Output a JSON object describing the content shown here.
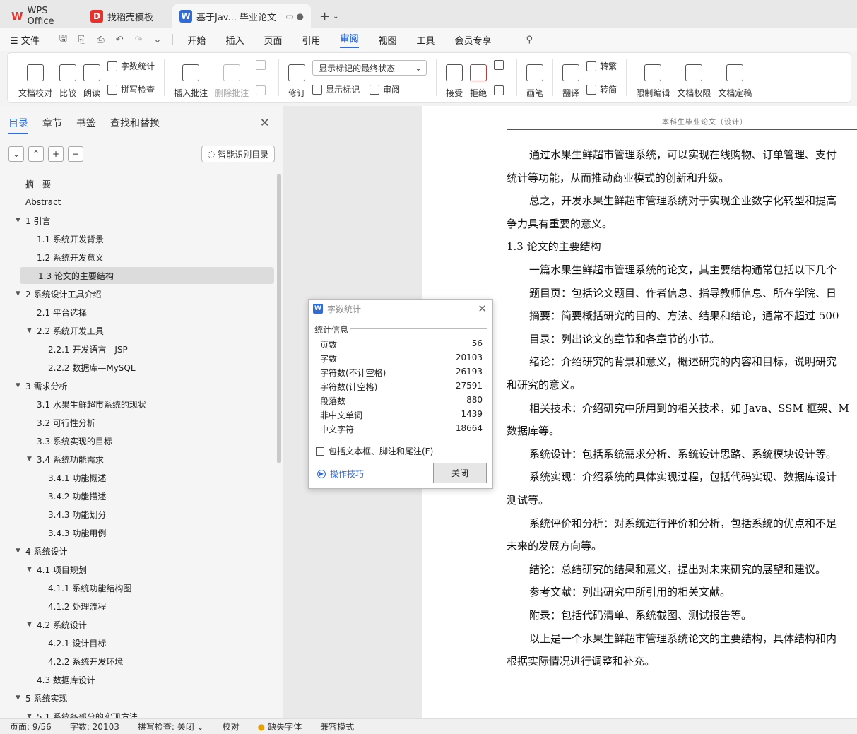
{
  "tabs": [
    {
      "label": "WPS Office",
      "icon": "wps-logo-icon"
    },
    {
      "label": "找稻壳模板",
      "icon": "docer-logo-icon"
    },
    {
      "label": "基于Jav... 毕业论文",
      "icon": "writer-logo-icon"
    }
  ],
  "menu": {
    "file": "文件",
    "items": [
      "开始",
      "插入",
      "页面",
      "引用",
      "审阅",
      "视图",
      "工具",
      "会员专享"
    ],
    "active": "审阅"
  },
  "ribbon": {
    "doc_check": "文档校对",
    "compare": "比较",
    "read_aloud": "朗读",
    "word_count": "字数统计",
    "spell_check": "拼写检查",
    "insert_comment": "插入批注",
    "delete_comment": "删除批注",
    "revise": "修订",
    "markup_state": "显示标记的最终状态",
    "show_markup": "显示标记",
    "review_pane": "审阅",
    "accept": "接受",
    "reject": "拒绝",
    "pen": "画笔",
    "translate": "翻译",
    "to_traditional": "转繁",
    "to_simplified": "转简",
    "restrict_edit": "限制编辑",
    "doc_permission": "文档权限",
    "doc_finalize": "文档定稿"
  },
  "nav": {
    "tabs": [
      "目录",
      "章节",
      "书签",
      "查找和替换"
    ],
    "active_tab": "目录",
    "smart_toc": "智能识别目录",
    "items": [
      {
        "label": "摘　要",
        "level": 0,
        "arrow": false
      },
      {
        "label": "Abstract",
        "level": 0,
        "arrow": false
      },
      {
        "label": "1 引言",
        "level": 0,
        "arrow": true
      },
      {
        "label": "1.1  系统开发背景",
        "level": 1,
        "arrow": false
      },
      {
        "label": "1.2  系统开发意义",
        "level": 1,
        "arrow": false
      },
      {
        "label": "1.3 论文的主要结构",
        "level": 1,
        "arrow": false,
        "selected": true
      },
      {
        "label": "2 系统设计工具介绍",
        "level": 0,
        "arrow": true
      },
      {
        "label": "2.1  平台选择",
        "level": 1,
        "arrow": false
      },
      {
        "label": "2.2  系统开发工具",
        "level": 1,
        "arrow": true
      },
      {
        "label": "2.2.1  开发语言—JSP",
        "level": 2,
        "arrow": false
      },
      {
        "label": "2.2.2  数据库—MySQL",
        "level": 2,
        "arrow": false
      },
      {
        "label": "3  需求分析",
        "level": 0,
        "arrow": true
      },
      {
        "label": "3.1  水果生鲜超市系统的现状",
        "level": 1,
        "arrow": false
      },
      {
        "label": "3.2  可行性分析",
        "level": 1,
        "arrow": false
      },
      {
        "label": "3.3  系统实现的目标",
        "level": 1,
        "arrow": false
      },
      {
        "label": "3.4  系统功能需求",
        "level": 1,
        "arrow": true
      },
      {
        "label": "3.4.1  功能概述",
        "level": 2,
        "arrow": false
      },
      {
        "label": "3.4.2  功能描述",
        "level": 2,
        "arrow": false
      },
      {
        "label": "3.4.3  功能划分",
        "level": 2,
        "arrow": false
      },
      {
        "label": "3.4.3  功能用例",
        "level": 2,
        "arrow": false
      },
      {
        "label": "4  系统设计",
        "level": 0,
        "arrow": true
      },
      {
        "label": "4.1  项目规划",
        "level": 1,
        "arrow": true
      },
      {
        "label": "4.1.1  系统功能结构图",
        "level": 2,
        "arrow": false
      },
      {
        "label": "4.1.2  处理流程",
        "level": 2,
        "arrow": false
      },
      {
        "label": "4.2  系统设计",
        "level": 1,
        "arrow": true
      },
      {
        "label": "4.2.1  设计目标",
        "level": 2,
        "arrow": false
      },
      {
        "label": "4.2.2  系统开发环境",
        "level": 2,
        "arrow": false
      },
      {
        "label": "4.3  数据库设计",
        "level": 1,
        "arrow": false
      },
      {
        "label": "5  系统实现",
        "level": 0,
        "arrow": true
      },
      {
        "label": "5.1  系统各部分的实现方法",
        "level": 1,
        "arrow": true
      }
    ]
  },
  "document": {
    "header": "本科生毕业论文（设计）",
    "lines": [
      {
        "text": "通过水果生鲜超市管理系统，可以实现在线购物、订单管理、支付",
        "indent": true
      },
      {
        "text": "统计等功能，从而推动商业模式的创新和升级。",
        "indent": false
      },
      {
        "text": "总之，开发水果生鲜超市管理系统对于实现企业数字化转型和提高",
        "indent": true
      },
      {
        "text": "争力具有重要的意义。",
        "indent": false
      },
      {
        "text": "1.3 论文的主要结构",
        "indent": false
      },
      {
        "text": "一篇水果生鲜超市管理系统的论文，其主要结构通常包括以下几个",
        "indent": true
      },
      {
        "text": "题目页：包括论文题目、作者信息、指导教师信息、所在学院、日",
        "indent": true
      },
      {
        "text": "摘要：简要概括研究的目的、方法、结果和结论，通常不超过 500",
        "indent": true
      },
      {
        "text": "目录：列出论文的章节和各章节的小节。",
        "indent": true
      },
      {
        "text": "绪论：介绍研究的背景和意义，概述研究的内容和目标，说明研究",
        "indent": true
      },
      {
        "text": "和研究的意义。",
        "indent": false
      },
      {
        "text": "相关技术：介绍研究中所用到的相关技术，如 Java、SSM 框架、M",
        "indent": true
      },
      {
        "text": "数据库等。",
        "indent": false
      },
      {
        "text": "系统设计：包括系统需求分析、系统设计思路、系统模块设计等。",
        "indent": true
      },
      {
        "text": "系统实现：介绍系统的具体实现过程，包括代码实现、数据库设计",
        "indent": true
      },
      {
        "text": "测试等。",
        "indent": false
      },
      {
        "text": "系统评价和分析：对系统进行评价和分析，包括系统的优点和不足",
        "indent": true
      },
      {
        "text": "未来的发展方向等。",
        "indent": false
      },
      {
        "text": "结论：总结研究的结果和意义，提出对未来研究的展望和建议。",
        "indent": true
      },
      {
        "text": "参考文献：列出研究中所引用的相关文献。",
        "indent": true
      },
      {
        "text": "附录：包括代码清单、系统截图、测试报告等。",
        "indent": true
      },
      {
        "text": "以上是一个水果生鲜超市管理系统论文的主要结构，具体结构和内",
        "indent": true
      },
      {
        "text": "根据实际情况进行调整和补充。",
        "indent": false
      }
    ]
  },
  "dialog": {
    "title": "字数统计",
    "section": "统计信息",
    "stats": [
      {
        "label": "页数",
        "value": "56"
      },
      {
        "label": "字数",
        "value": "20103"
      },
      {
        "label": "字符数(不计空格)",
        "value": "26193"
      },
      {
        "label": "字符数(计空格)",
        "value": "27591"
      },
      {
        "label": "段落数",
        "value": "880"
      },
      {
        "label": "非中文单词",
        "value": "1439"
      },
      {
        "label": "中文字符",
        "value": "18664"
      }
    ],
    "checkbox_label": "包括文本框、脚注和尾注(F)",
    "tips": "操作技巧",
    "close": "关闭"
  },
  "status": {
    "page": "页面: 9/56",
    "words": "字数: 20103",
    "spell": "拼写检查: 关闭",
    "proof": "校对",
    "missing_font": "缺失字体",
    "compat": "兼容模式"
  },
  "colors": {
    "accent": "#2f6bd9",
    "wps_red": "#e8312a"
  }
}
